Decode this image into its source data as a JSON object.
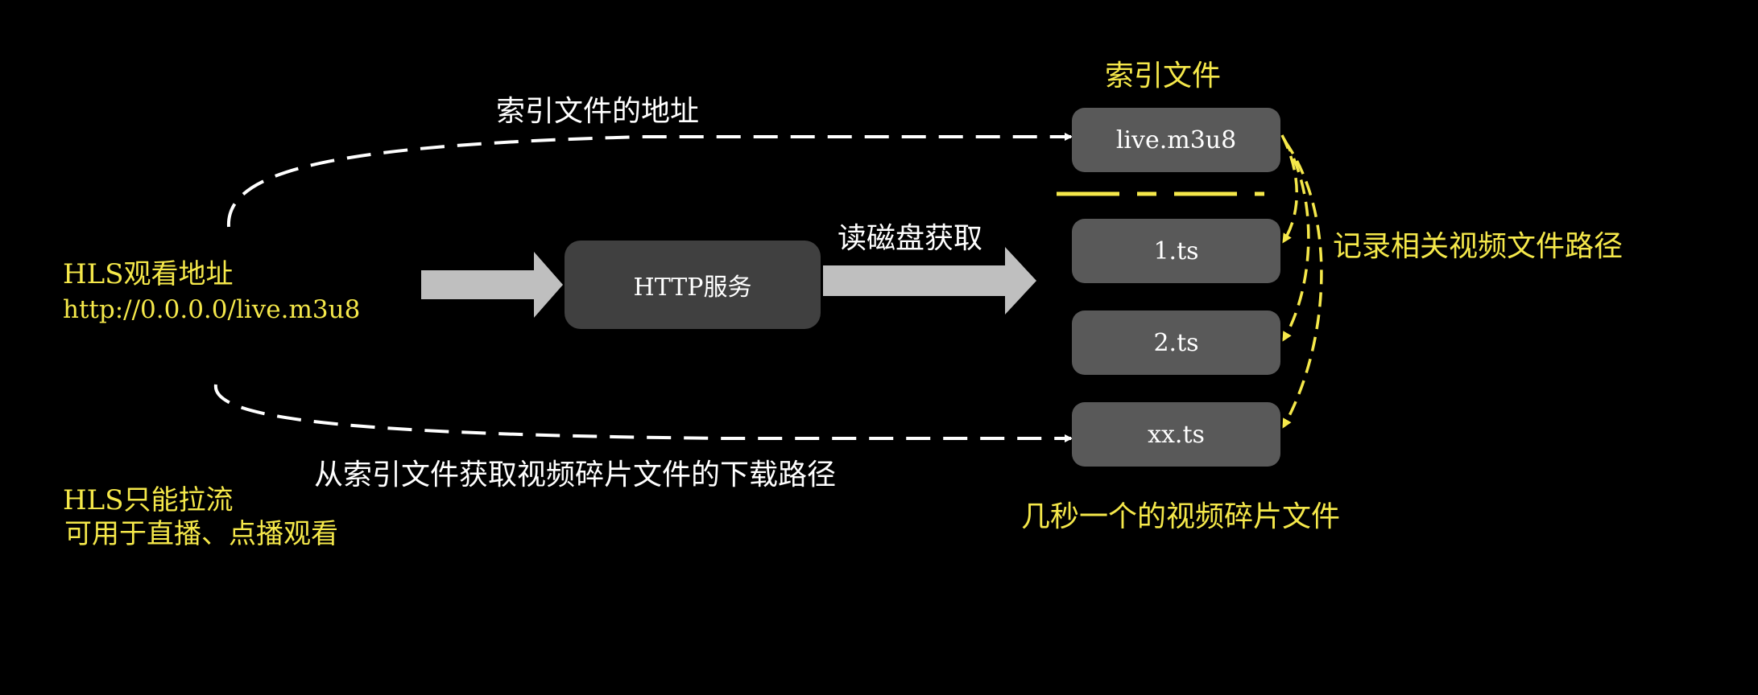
{
  "colors": {
    "background": "#000000",
    "highlight": "#f5e84a",
    "text": "#ffffff",
    "box": "#595959",
    "server_box": "#404040",
    "arrow": "#bfbfbf"
  },
  "source": {
    "title": "HLS观看地址",
    "url": "http://0.0.0.0/live.m3u8"
  },
  "notes": {
    "line1": "HLS只能拉流",
    "line2": "可用于直播、点播观看"
  },
  "server": {
    "label": "HTTP服务",
    "read_label": "读磁盘获取"
  },
  "flows": {
    "index_address": "索引文件的地址",
    "download_path": "从索引文件获取视频碎片文件的下载路径",
    "record_paths": "记录相关视频文件路径"
  },
  "files": {
    "index_title": "索引文件",
    "index_file": "live.m3u8",
    "segments": [
      "1.ts",
      "2.ts",
      "xx.ts"
    ],
    "segments_caption": "几秒一个的视频碎片文件"
  }
}
